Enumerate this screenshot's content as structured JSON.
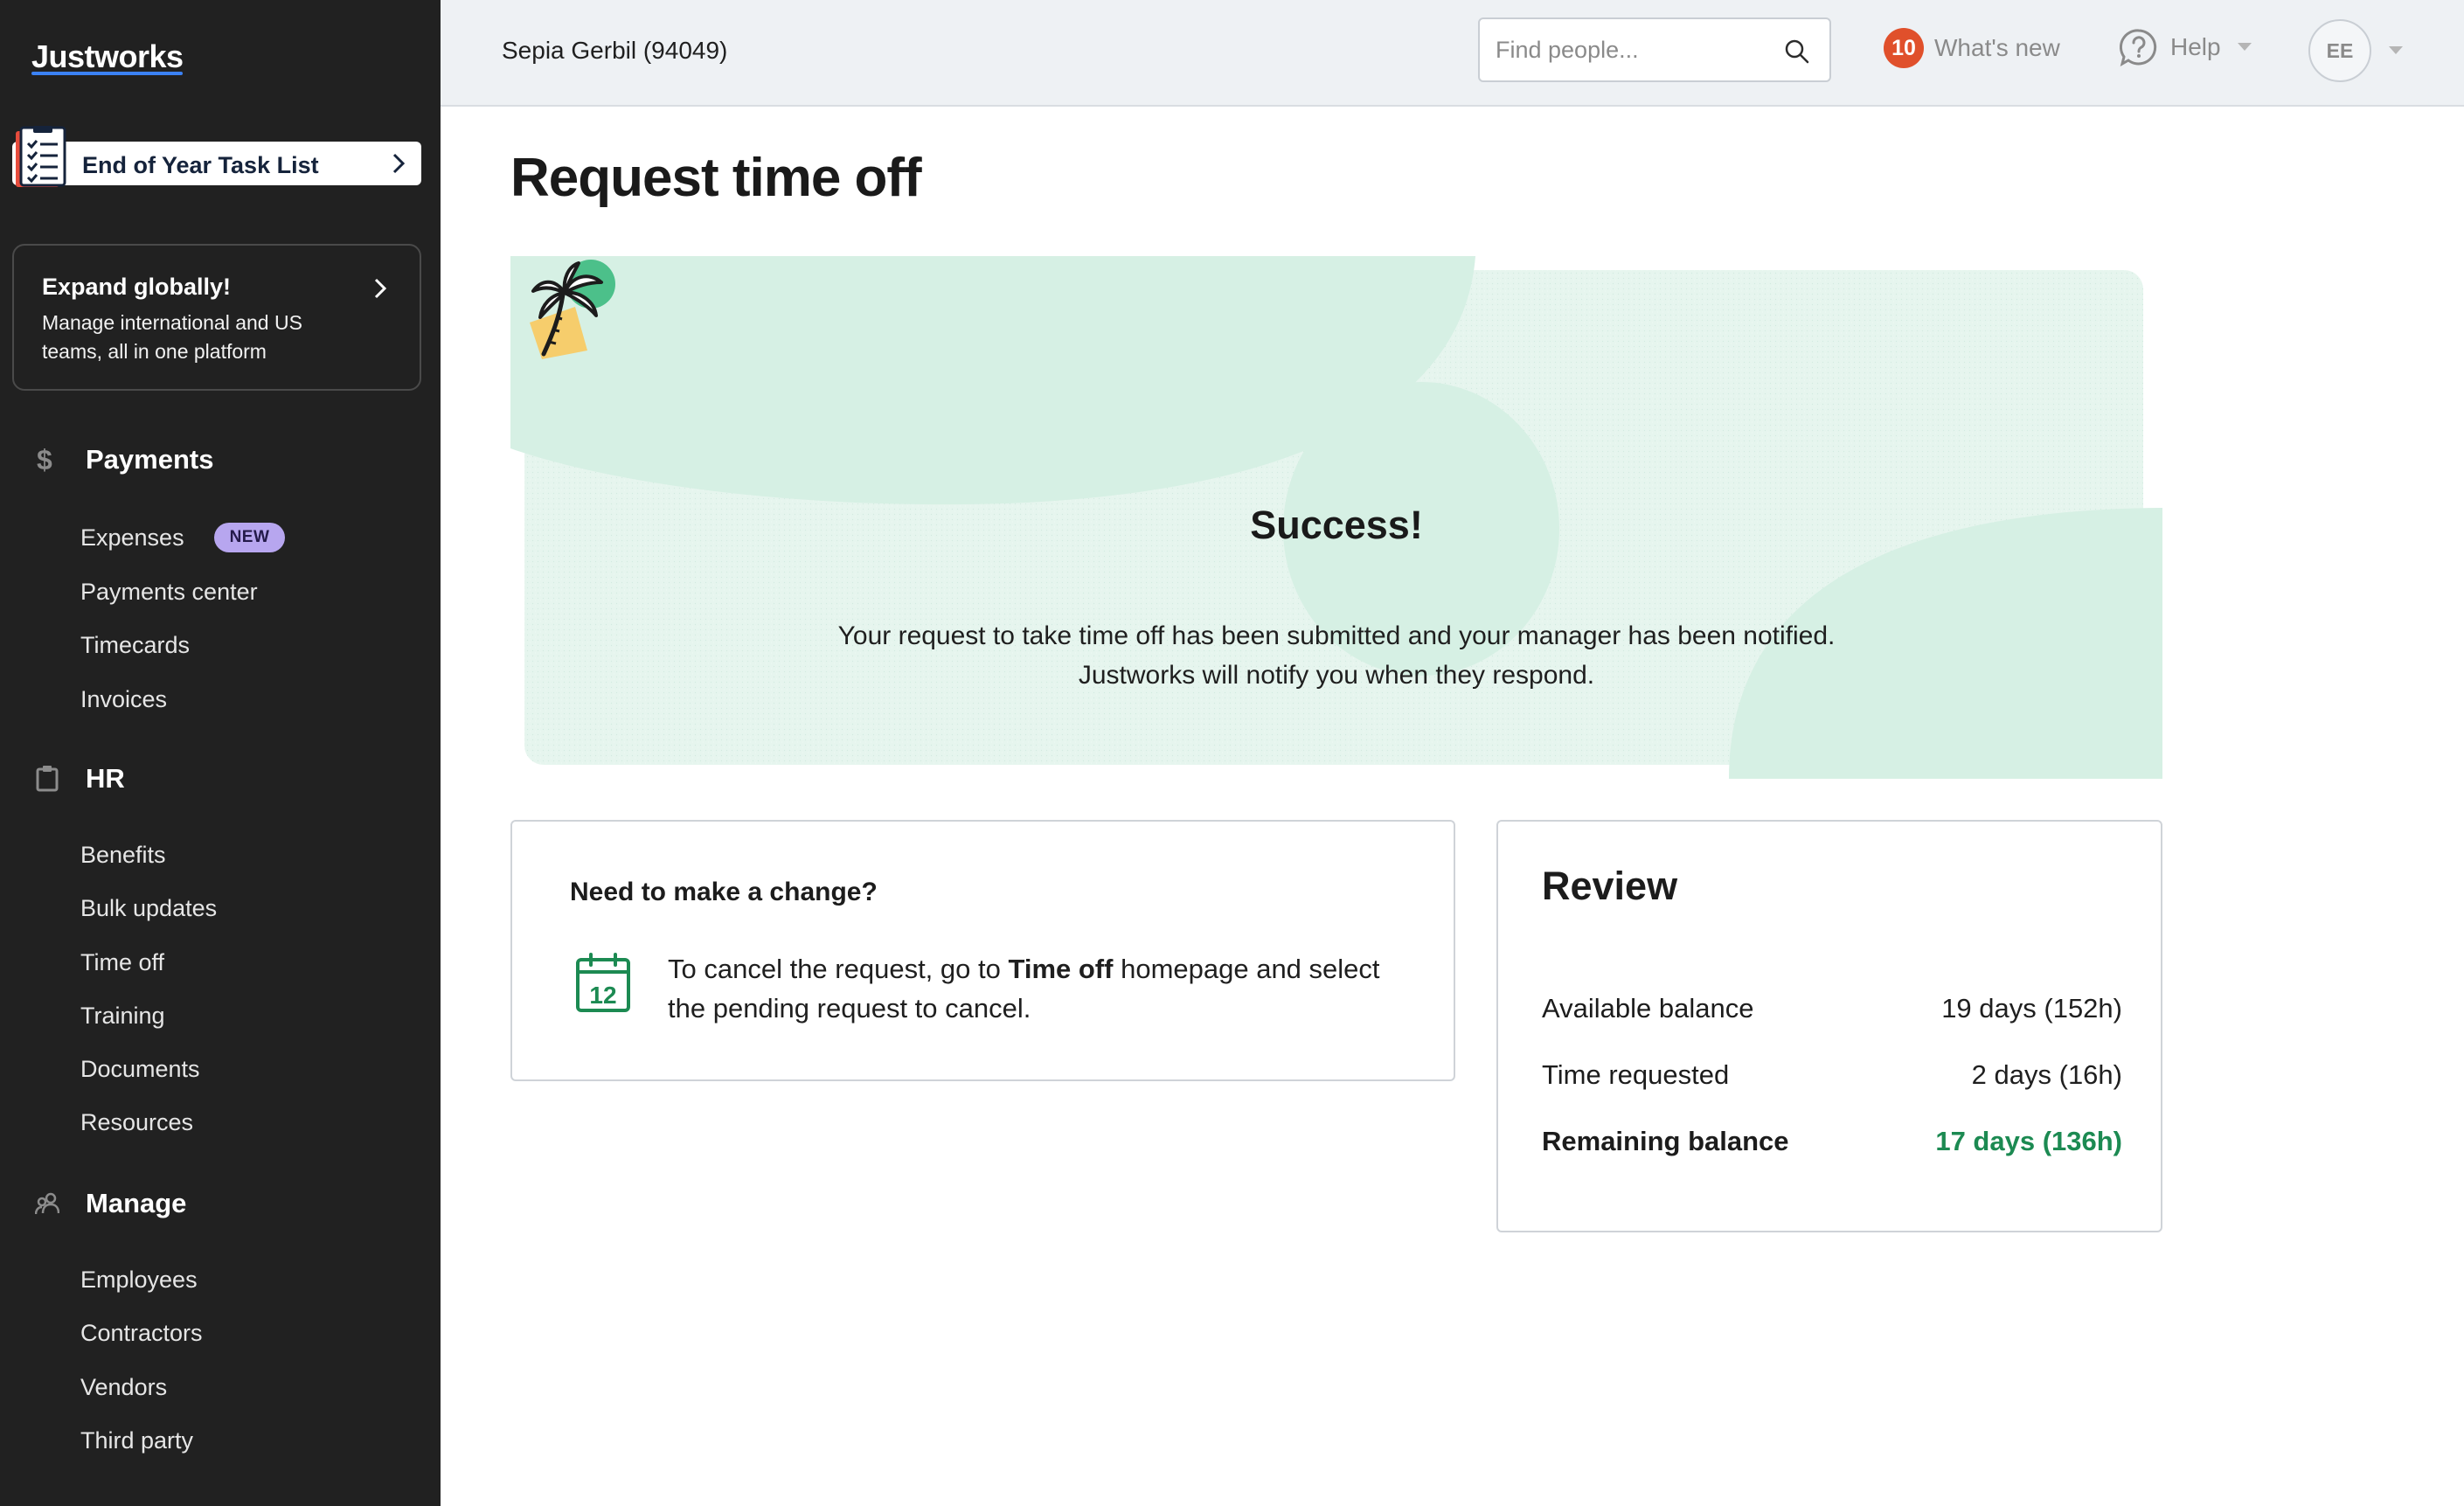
{
  "sidebar": {
    "logo": "Justworks",
    "task_list": {
      "label": "End of Year Task List"
    },
    "promo": {
      "title": "Expand globally!",
      "text": "Manage international and US teams, all in one platform"
    },
    "sections": {
      "payments": {
        "label": "Payments",
        "icon": "dollar-icon",
        "items": [
          "Expenses",
          "Payments center",
          "Timecards",
          "Invoices"
        ],
        "expenses_badge": "NEW"
      },
      "hr": {
        "label": "HR",
        "icon": "clipboard-icon",
        "items": [
          "Benefits",
          "Bulk updates",
          "Time off",
          "Training",
          "Documents",
          "Resources"
        ]
      },
      "manage": {
        "label": "Manage",
        "icon": "people-icon",
        "items": [
          "Employees",
          "Contractors",
          "Vendors",
          "Third party"
        ]
      }
    }
  },
  "header": {
    "company": "Sepia Gerbil (94049)",
    "search_placeholder": "Find people...",
    "whats_new": {
      "count": "10",
      "label": "What's new"
    },
    "help_label": "Help",
    "avatar_initials": "EE"
  },
  "main": {
    "title": "Request time off",
    "success": {
      "title": "Success!",
      "line1": "Your request to take time off has been submitted and your manager has been notified.",
      "line2": "Justworks will notify you when they respond."
    },
    "change": {
      "title": "Need to make a change?",
      "text_before": "To cancel the request, go to ",
      "text_bold": "Time off",
      "text_after": " homepage and select the pending request to cancel.",
      "calendar_day": "12"
    },
    "review": {
      "title": "Review",
      "rows": [
        {
          "label": "Available balance",
          "value": "19 days (152h)"
        },
        {
          "label": "Time requested",
          "value": "2 days (16h)"
        },
        {
          "label": "Remaining balance",
          "value": "17 days (136h)"
        }
      ]
    }
  },
  "colors": {
    "sidebar_bg": "#212121",
    "header_bg": "#eef1f4",
    "hero_mint": "#ddf2e8",
    "accent_green": "#1c8a52",
    "badge_orange": "#e0502b",
    "badge_new_purple": "#b7a6ef"
  }
}
